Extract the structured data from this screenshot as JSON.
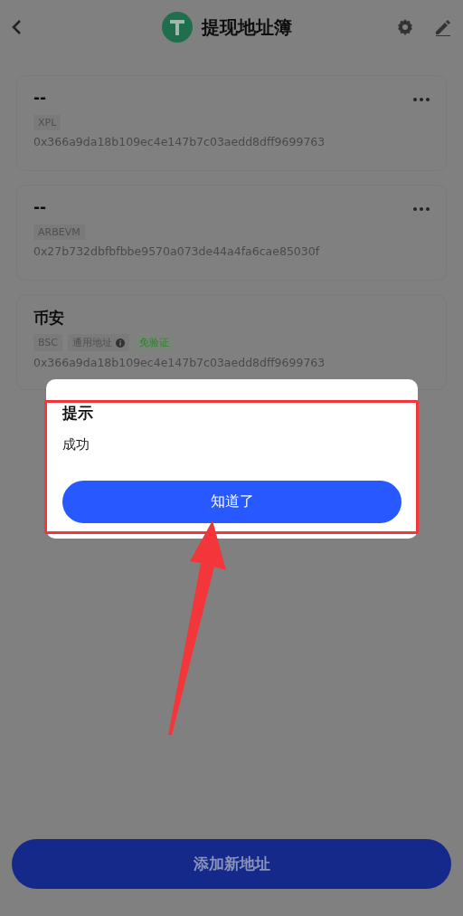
{
  "header": {
    "title": "提现地址簿"
  },
  "cards": [
    {
      "title": "--",
      "menu": true,
      "tags": [
        {
          "label": "XPL",
          "kind": "plain"
        }
      ],
      "address": "0x366a9da18b109ec4e147b7c03aedd8dff9699763"
    },
    {
      "title": "--",
      "menu": true,
      "tags": [
        {
          "label": "ARBEVM",
          "kind": "plain"
        }
      ],
      "address": "0x27b732dbfbfbbe9570a073de44a4fa6cae85030f"
    },
    {
      "title": "币安",
      "menu": false,
      "tags": [
        {
          "label": "BSC",
          "kind": "plain"
        },
        {
          "label": "通用地址",
          "kind": "info"
        },
        {
          "label": "免验证",
          "kind": "green"
        }
      ],
      "address": "0x366a9da18b109ec4e147b7c03aedd8dff9699763"
    }
  ],
  "dialog": {
    "title": "提示",
    "message": "成功",
    "button": "知道了"
  },
  "bottom_button": "添加新地址"
}
